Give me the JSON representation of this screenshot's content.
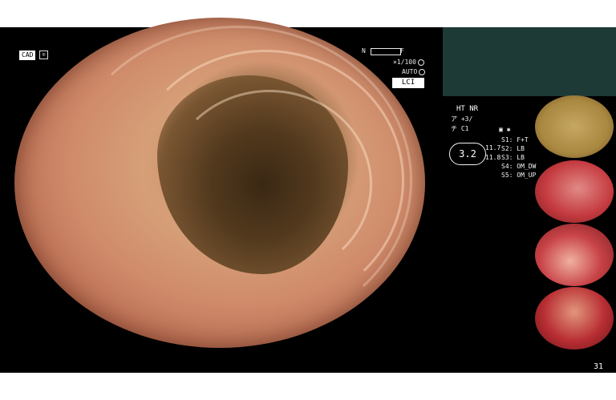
{
  "overlay": {
    "cad_label": "CAD",
    "cad_symbol": "⊙",
    "nf_left": "N",
    "nf_right": "F",
    "zoom": "×1/100",
    "auto": "AUTO",
    "lci_label": "LCI"
  },
  "info_panel": {
    "ht_nr": "HT NR",
    "line_a": "ア +3/",
    "line_b": "チ  C1",
    "gauge_value": "3.2",
    "val_a": "11.7",
    "val_b": "11.8",
    "s1": "S1: F+T",
    "s2": "S2: LB",
    "s3": "S3: LB",
    "s4": "S4: OM_DW",
    "s5": "S5: OM_UP"
  },
  "thumbnails": [
    {
      "name": "thumbnail-1",
      "color": "#c6a763"
    },
    {
      "name": "thumbnail-2",
      "color": "#c53b40"
    },
    {
      "name": "thumbnail-3",
      "color": "#c84347"
    },
    {
      "name": "thumbnail-4",
      "color": "#b82e33"
    }
  ],
  "page_number": "31",
  "colors": {
    "screen_bg": "#000000",
    "teal_panel": "#1d3a36"
  }
}
